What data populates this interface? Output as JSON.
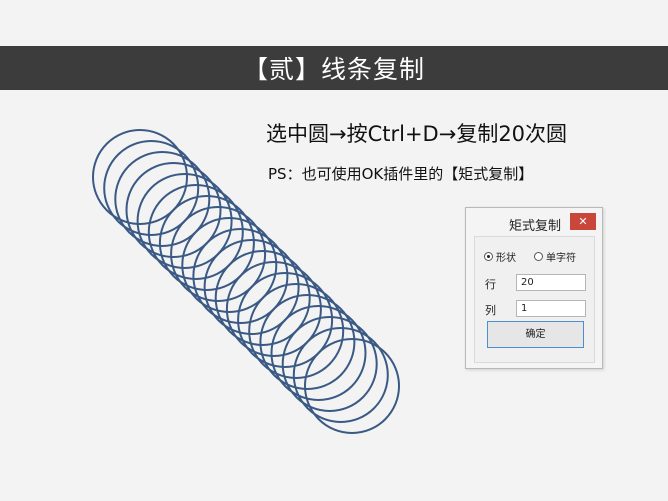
{
  "slide": {
    "title": "【贰】线条复制",
    "headline": "选中圆→按Ctrl+D→复制20次圆",
    "ps_line": "PS：也可使用OK插件里的【矩式复制】"
  },
  "illustration": {
    "ring_count": 20,
    "ring_color": "#3a5a85"
  },
  "dialog": {
    "title": "矩式复制",
    "close_icon": "close-icon",
    "radio_shape_label": "形状",
    "radio_char_label": "单字符",
    "selected_option": "形状",
    "row_label": "行",
    "row_value": "20",
    "col_label": "列",
    "col_value": "1",
    "ok_label": "确定"
  },
  "colors": {
    "title_bar": "#3c3c3c",
    "background": "#f3f3f3",
    "close_button": "#c8473a",
    "ok_border": "#4d8fce"
  }
}
